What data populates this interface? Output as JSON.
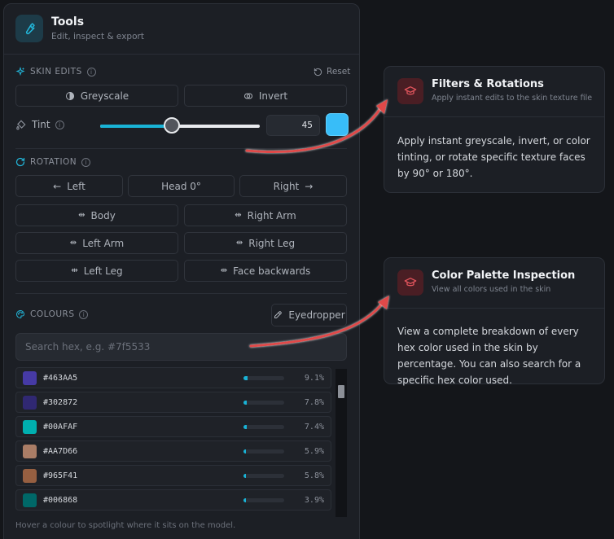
{
  "panel": {
    "title": "Tools",
    "subtitle": "Edit, inspect & export",
    "icon": "wrench-icon"
  },
  "skin_edits": {
    "label": "SKIN EDITS",
    "reset_label": "Reset",
    "greyscale_label": "Greyscale",
    "invert_label": "Invert",
    "tint_label": "Tint",
    "tint_value": "45",
    "tint_fraction": 0.45,
    "tint_color": "#38bdf8"
  },
  "rotation": {
    "label": "ROTATION",
    "buttons": {
      "left": "Left",
      "head": "Head 0°",
      "right": "Right",
      "body": "Body",
      "right_arm": "Right Arm",
      "left_arm": "Left Arm",
      "right_leg": "Right Leg",
      "left_leg": "Left Leg",
      "face_backwards": "Face backwards"
    }
  },
  "colours": {
    "label": "COLOURS",
    "eyedropper_label": "Eyedropper",
    "search_placeholder": "Search hex, e.g. #7f5533",
    "rows": [
      {
        "hex": "#463AA5",
        "color": "#463AA5",
        "percent": "9.1%",
        "fraction": 0.091
      },
      {
        "hex": "#302872",
        "color": "#302872",
        "percent": "7.8%",
        "fraction": 0.078
      },
      {
        "hex": "#00AFAF",
        "color": "#00AFAF",
        "percent": "7.4%",
        "fraction": 0.074
      },
      {
        "hex": "#AA7D66",
        "color": "#AA7D66",
        "percent": "5.9%",
        "fraction": 0.059
      },
      {
        "hex": "#965F41",
        "color": "#965F41",
        "percent": "5.8%",
        "fraction": 0.058
      },
      {
        "hex": "#006868",
        "color": "#006868",
        "percent": "3.9%",
        "fraction": 0.039
      }
    ],
    "hint": "Hover a colour to spotlight where it sits on the model."
  },
  "callouts": {
    "filters": {
      "title": "Filters & Rotations",
      "subtitle": "Apply instant edits to the skin texture file",
      "body": "Apply instant greyscale, invert, or color tinting, or rotate specific texture faces by 90° or 180°."
    },
    "palette": {
      "title": "Color Palette Inspection",
      "subtitle": "View all colors used in the skin",
      "body": "View a complete breakdown of every hex color used in the skin by percentage. You can also search for a specific hex color used."
    }
  },
  "colors": {
    "accent": "#19b3d6",
    "callout_arrow": "#e04848",
    "callout_icon": "#e0545c"
  }
}
